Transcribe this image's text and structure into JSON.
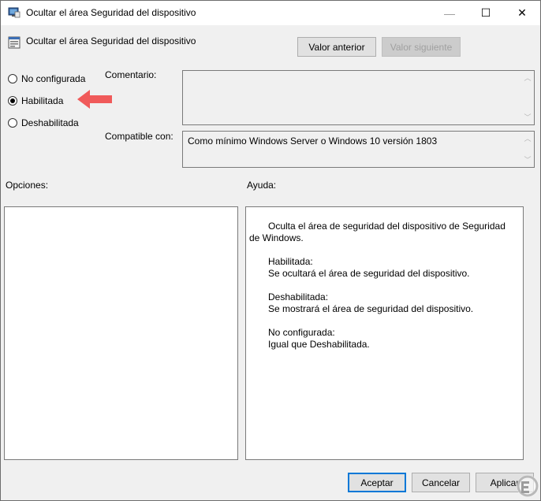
{
  "window": {
    "title": "Ocultar el área Seguridad del dispositivo",
    "controls": {
      "minimize": "—",
      "maximize": "☐",
      "close": "✕"
    }
  },
  "header": {
    "policy_name": "Ocultar el área Seguridad del dispositivo",
    "prev_button": "Valor anterior",
    "next_button": "Valor siguiente"
  },
  "state": {
    "options": [
      {
        "label": "No configurada",
        "checked": false
      },
      {
        "label": "Habilitada",
        "checked": true
      },
      {
        "label": "Deshabilitada",
        "checked": false
      }
    ]
  },
  "comment": {
    "label": "Comentario:",
    "value": ""
  },
  "compatible": {
    "label": "Compatible con:",
    "value": "Como mínimo Windows Server o Windows 10 versión 1803"
  },
  "options_panel": {
    "label": "Opciones:"
  },
  "help_panel": {
    "label": "Ayuda:",
    "intro": "Oculta el área de seguridad del dispositivo de Seguridad de Windows.",
    "enabled_title": "Habilitada:",
    "enabled_text": "Se ocultará el área de seguridad del dispositivo.",
    "disabled_title": "Deshabilitada:",
    "disabled_text": "Se mostrará el área de seguridad del dispositivo.",
    "notconf_title": "No configurada:",
    "notconf_text": "Igual que Deshabilitada."
  },
  "footer": {
    "ok": "Aceptar",
    "cancel": "Cancelar",
    "apply": "Aplicar"
  },
  "colors": {
    "accent": "#0078d7",
    "arrow": "#f05a5a"
  }
}
